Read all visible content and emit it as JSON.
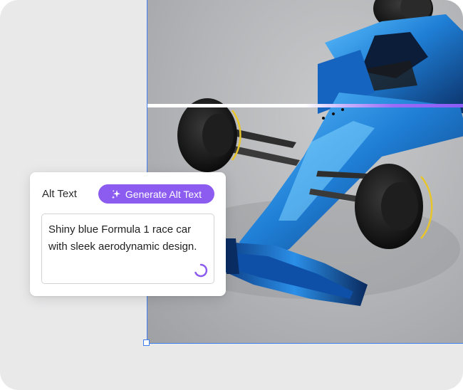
{
  "alt_text_panel": {
    "label": "Alt Text",
    "generate_button_label": "Generate Alt Text",
    "textarea_value": "Shiny blue Formula 1 race car with sleek aerodynamic design.",
    "status": "loading"
  },
  "image": {
    "subject": "race-car-photo"
  },
  "colors": {
    "accent_purple": "#8c5cf0",
    "selection_blue": "#3f7ff0",
    "car_blue": "#1f7fd6"
  },
  "icons": {
    "generate": "sparkle-icon",
    "loading": "spinner-icon"
  }
}
